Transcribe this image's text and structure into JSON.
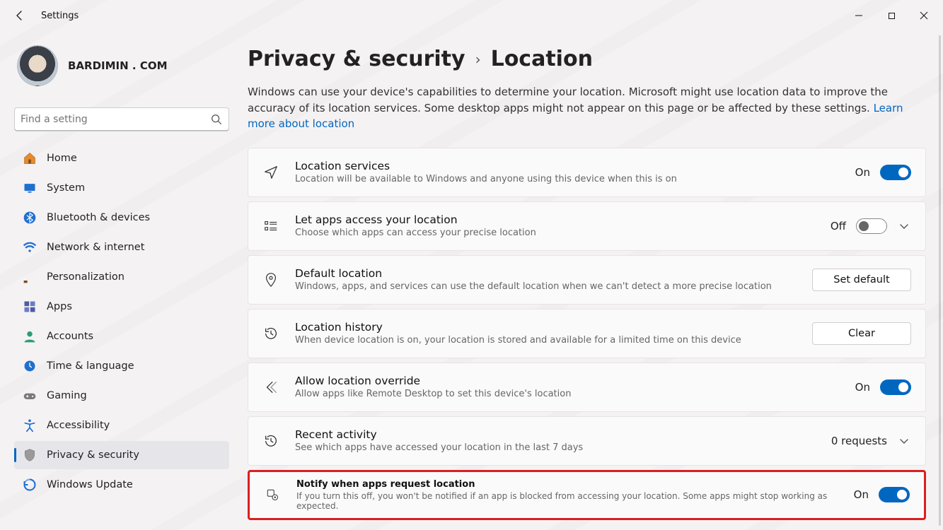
{
  "app_title": "Settings",
  "profile": {
    "name": "BARDIMIN . COM",
    "email": " "
  },
  "search": {
    "placeholder": "Find a setting"
  },
  "sidebar": {
    "items": [
      {
        "label": "Home",
        "icon": "home"
      },
      {
        "label": "System",
        "icon": "system"
      },
      {
        "label": "Bluetooth & devices",
        "icon": "bluetooth"
      },
      {
        "label": "Network & internet",
        "icon": "wifi"
      },
      {
        "label": "Personalization",
        "icon": "brush"
      },
      {
        "label": "Apps",
        "icon": "apps"
      },
      {
        "label": "Accounts",
        "icon": "accounts"
      },
      {
        "label": "Time & language",
        "icon": "time"
      },
      {
        "label": "Gaming",
        "icon": "gaming"
      },
      {
        "label": "Accessibility",
        "icon": "accessibility"
      },
      {
        "label": "Privacy & security",
        "icon": "privacy",
        "active": true
      },
      {
        "label": "Windows Update",
        "icon": "update"
      }
    ]
  },
  "breadcrumb": {
    "parent": "Privacy & security",
    "current": "Location"
  },
  "intro_text": "Windows can use your device's capabilities to determine your location. Microsoft might use location data to improve the accuracy of its location services. Some desktop apps might not appear on this page or be affected by these settings.  ",
  "learn_more_label": "Learn more about location",
  "cards": {
    "location_services": {
      "title": "Location services",
      "subtitle": "Location will be available to Windows and anyone using this device when this is on",
      "state_label": "On",
      "state": true
    },
    "apps_access": {
      "title": "Let apps access your location",
      "subtitle": "Choose which apps can access your precise location",
      "state_label": "Off",
      "state": false
    },
    "default_location": {
      "title": "Default location",
      "subtitle": "Windows, apps, and services can use the default location when we can't detect a more precise location",
      "button_label": "Set default"
    },
    "location_history": {
      "title": "Location history",
      "subtitle": "When device location is on, your location is stored and available for a limited time on this device",
      "button_label": "Clear"
    },
    "allow_override": {
      "title": "Allow location override",
      "subtitle": "Allow apps like Remote Desktop to set this device's location",
      "state_label": "On",
      "state": true
    },
    "recent_activity": {
      "title": "Recent activity",
      "subtitle": "See which apps have accessed your location in the last 7 days",
      "requests_label": "0 requests"
    },
    "notify": {
      "title": "Notify when apps request location",
      "subtitle": "If you turn this off, you won't be notified if an app is blocked from accessing your location. Some apps might stop working as expected.",
      "state_label": "On",
      "state": true
    }
  },
  "icon_colors": {
    "home": "#e58a2f",
    "system": "#1f6fd0",
    "bluetooth": "#1f6fd0",
    "wifi": "#1f6fd0",
    "brush": "#d06a1f",
    "apps": "#4b5ca5",
    "accounts": "#2d9e72",
    "time": "#1f6fd0",
    "gaming": "#7a7a7a",
    "accessibility": "#1f6fd0",
    "privacy": "#7a7a7a",
    "update": "#1f6fd0"
  }
}
